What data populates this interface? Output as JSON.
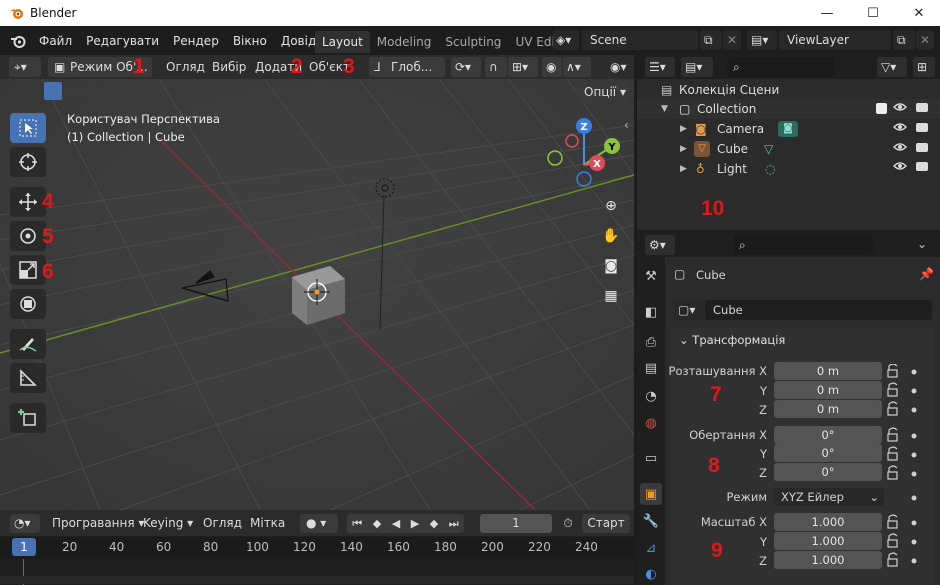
{
  "window": {
    "title": "Blender",
    "minimize": "—",
    "maximize": "☐",
    "close": "✕"
  },
  "menu": [
    "Файл",
    "Редагувати",
    "Рендер",
    "Вікно",
    "Довідка"
  ],
  "workspace_tabs": [
    "Layout",
    "Modeling",
    "Sculpting",
    "UV Editi"
  ],
  "scene_field": "Scene",
  "view_layer_field": "ViewLayer",
  "viewport": {
    "mode": "Режим Об'...",
    "menus": [
      "Огляд",
      "Вибір",
      "Додати",
      "Об'єкт"
    ],
    "orientation": "Глоб...",
    "options": "Опції",
    "overlay_title": "Користувач Перспектива",
    "overlay_sub": "(1) Collection | Cube",
    "gizmo_axes": {
      "x": "X",
      "y": "Y",
      "z": "Z"
    }
  },
  "annotations": [
    "1",
    "2",
    "3",
    "4",
    "5",
    "6",
    "7",
    "8",
    "9",
    "10"
  ],
  "timeline": {
    "playback": "Програвання",
    "keying": "Keying",
    "view": "Огляд",
    "marker": "Мітка",
    "frame": "1",
    "start_label": "Старт",
    "current_frame_badge": "1",
    "ruler": [
      "20",
      "40",
      "60",
      "80",
      "100",
      "120",
      "140",
      "160",
      "180",
      "200",
      "220",
      "240"
    ]
  },
  "outliner": {
    "root": "Колекція Сцени",
    "collection": "Collection",
    "items": [
      "Camera",
      "Cube",
      "Light"
    ]
  },
  "properties": {
    "object_name_header": "Cube",
    "object_name_field": "Cube",
    "panel_title": "Трансформація",
    "location_label": "Розташування X",
    "rotation_label": "Обертання X",
    "scale_label": "Масштаб X",
    "axis_y": "Y",
    "axis_z": "Z",
    "location": [
      "0 m",
      "0 m",
      "0 m"
    ],
    "rotation": [
      "0°",
      "0°",
      "0°"
    ],
    "mode_label": "Режим",
    "mode_value": "XYZ Ейлер",
    "scale": [
      "1.000",
      "1.000",
      "1.000"
    ]
  },
  "colors": {
    "accent": "#4772b3",
    "annotation": "#e0181a",
    "x_axis": "#8f2c33",
    "y_axis": "#6b8f23"
  }
}
